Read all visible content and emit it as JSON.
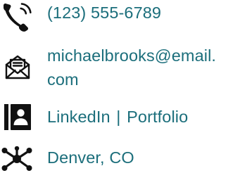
{
  "contact": {
    "phone": {
      "icon": "phone-icon",
      "text": "(123) 555-6789"
    },
    "email": {
      "icon": "email-icon",
      "line1": "michaelbrooks@email.",
      "line2": "com"
    },
    "links": {
      "icon": "profile-card-icon",
      "linkedin": "LinkedIn",
      "separator": "|",
      "portfolio": "Portfolio"
    },
    "location": {
      "icon": "network-icon",
      "text": "Denver, CO"
    }
  },
  "colors": {
    "text": "#1b6e7b",
    "icon": "#111111"
  }
}
